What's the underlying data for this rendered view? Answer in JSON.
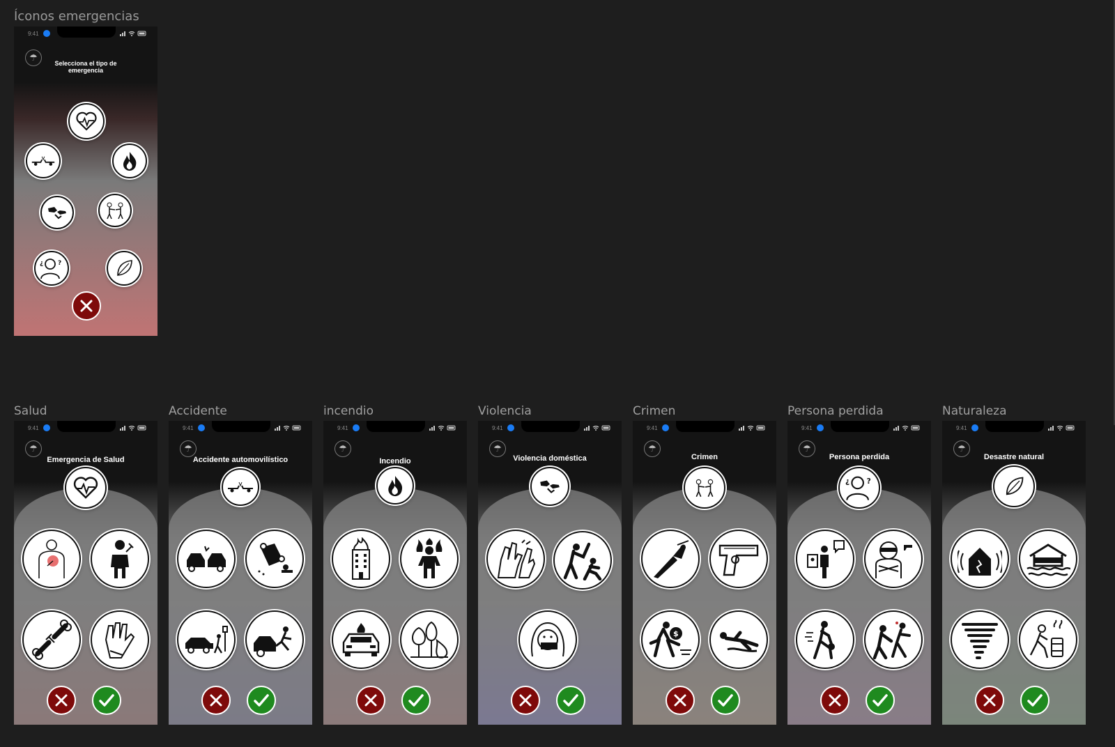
{
  "canvas": {
    "section_title": "Íconos emergencias"
  },
  "status_bar": {
    "time": "9:41"
  },
  "main_menu": {
    "title_line1": "Selecciona el tipo de",
    "title_line2": "emergencia",
    "options": [
      {
        "name": "salud",
        "icon": "heartbeat-icon"
      },
      {
        "name": "accidente",
        "icon": "car-crash-icon"
      },
      {
        "name": "incendio",
        "icon": "flame-icon"
      },
      {
        "name": "violencia",
        "icon": "handshake-violence-icon"
      },
      {
        "name": "crimen",
        "icon": "robbery-icon"
      },
      {
        "name": "persona-perdida",
        "icon": "missing-person-icon"
      },
      {
        "name": "naturaleza",
        "icon": "leaf-icon"
      }
    ]
  },
  "frames": [
    {
      "label": "Salud",
      "title": "Emergencia de Salud",
      "icon": "heartbeat-icon",
      "sub_icons": [
        "chest-pain-icon",
        "choking-icon",
        "broken-bone-icon",
        "glove-icon"
      ],
      "gradient": [
        "#141414",
        "#b06060"
      ]
    },
    {
      "label": "Accidente",
      "title": "Accidente automovilístico",
      "icon": "car-crash-icon",
      "sub_icons": [
        "car-collision-icon",
        "car-rollover-icon",
        "pedestrian-hit-icon",
        "car-run-over-icon"
      ],
      "gradient": [
        "#141414",
        "#6f6aa0"
      ]
    },
    {
      "label": "incendio",
      "title": "Incendio",
      "icon": "flame-icon",
      "sub_icons": [
        "building-fire-icon",
        "person-on-fire-icon",
        "car-fire-icon",
        "forest-fire-icon"
      ],
      "gradient": [
        "#141414",
        "#b86a6a"
      ]
    },
    {
      "label": "Violencia",
      "title": "Violencia doméstica",
      "icon": "handshake-violence-icon",
      "sub_icons": [
        "fighting-hands-icon",
        "aggressor-icon",
        "silenced-victim-icon"
      ],
      "gradient": [
        "#141414",
        "#6a5fd0"
      ]
    },
    {
      "label": "Crimen",
      "title": "Crimen",
      "icon": "robbery-icon",
      "sub_icons": [
        "knife-icon",
        "gun-icon",
        "thief-running-icon",
        "body-lying-icon"
      ],
      "gradient": [
        "#141414",
        "#b08c70"
      ]
    },
    {
      "label": "Persona perdida",
      "title": "Persona perdida",
      "icon": "missing-person-icon",
      "sub_icons": [
        "missing-report-icon",
        "kidnapper-icon",
        "child-running-icon",
        "abduction-icon"
      ],
      "gradient": [
        "#141414",
        "#a870a0"
      ]
    },
    {
      "label": "Naturaleza",
      "title": "Desastre natural",
      "icon": "leaf-icon",
      "sub_icons": [
        "earthquake-house-icon",
        "flood-house-icon",
        "tornado-icon",
        "chemical-spill-icon"
      ],
      "gradient": [
        "#141414",
        "#6a9a6a"
      ]
    }
  ],
  "colors": {
    "background": "#1e1e1e",
    "cancel": "#7e0a0a",
    "confirm": "#1f8a1f",
    "arch": "#808080"
  }
}
